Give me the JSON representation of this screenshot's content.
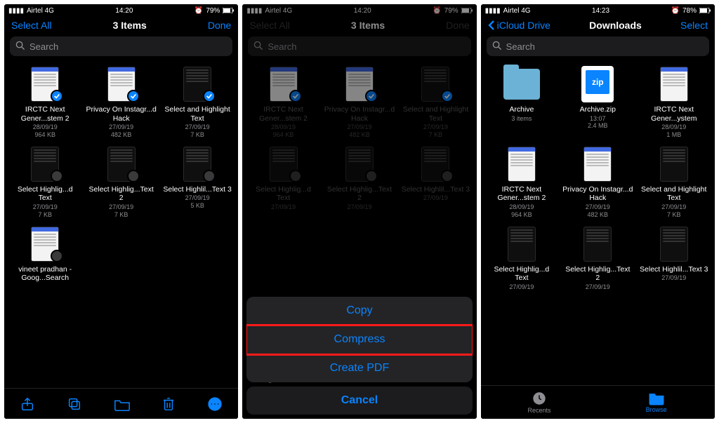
{
  "shared": {
    "carrier": "Airtel 4G",
    "signal_bars": 4,
    "search_placeholder": "Search"
  },
  "phone1": {
    "time": "14:20",
    "battery": "79%",
    "nav_left": "Select All",
    "nav_title": "3 Items",
    "nav_right": "Done",
    "files": [
      {
        "name": "IRCTC Next Gener...stem 2",
        "date": "28/09/19",
        "size": "964 KB",
        "thumb": "doc-light",
        "selected": true
      },
      {
        "name": "Privacy On Instagr...d Hack",
        "date": "27/09/19",
        "size": "482 KB",
        "thumb": "doc-light",
        "selected": true
      },
      {
        "name": "Select and Highlight Text",
        "date": "27/09/19",
        "size": "7 KB",
        "thumb": "doc-dark",
        "selected": true
      },
      {
        "name": "Select Highlig...d Text",
        "date": "27/09/19",
        "size": "7 KB",
        "thumb": "doc-dark",
        "selected": false
      },
      {
        "name": "Select Highlig...Text 2",
        "date": "27/09/19",
        "size": "7 KB",
        "thumb": "doc-dark",
        "selected": false
      },
      {
        "name": "Select Highlil...Text 3",
        "date": "27/09/19",
        "size": "5 KB",
        "thumb": "doc-dark",
        "selected": false
      },
      {
        "name": "vineet pradhan - Goog...Search",
        "date": "",
        "size": "",
        "thumb": "doc-light",
        "selected": false
      }
    ],
    "toolbar_icons": [
      "share",
      "duplicate",
      "move",
      "trash",
      "more"
    ]
  },
  "phone2": {
    "time": "14:20",
    "battery": "79%",
    "nav_left": "Select All",
    "nav_title": "3 Items",
    "nav_right": "Done",
    "files": [
      {
        "name": "IRCTC Next Gener...stem 2",
        "date": "28/09/19",
        "size": "964 KB",
        "thumb": "doc-light",
        "selected": true
      },
      {
        "name": "Privacy On Instagr...d Hack",
        "date": "27/09/19",
        "size": "482 KB",
        "thumb": "doc-light",
        "selected": true
      },
      {
        "name": "Select and Highlight Text",
        "date": "27/09/19",
        "size": "7 KB",
        "thumb": "doc-dark",
        "selected": true
      },
      {
        "name": "Select Highlig...d Text",
        "date": "27/09/19",
        "size": "",
        "thumb": "doc-dark",
        "selected": false
      },
      {
        "name": "Select Highlig...Text 2",
        "date": "27/09/19",
        "size": "",
        "thumb": "doc-dark",
        "selected": false
      },
      {
        "name": "Select Highlil...Text 3",
        "date": "27/09/19",
        "size": "",
        "thumb": "doc-dark",
        "selected": false
      }
    ],
    "peek_row": "- Goog   Search",
    "actions": [
      "Copy",
      "Compress",
      "Create PDF"
    ],
    "highlight_action_index": 1,
    "cancel": "Cancel"
  },
  "phone3": {
    "time": "14:23",
    "battery": "78%",
    "nav_back": "iCloud Drive",
    "nav_title": "Downloads",
    "nav_right": "Select",
    "files": [
      {
        "name": "Archive",
        "date": "3 items",
        "size": "",
        "thumb": "folder"
      },
      {
        "name": "Archive.zip",
        "date": "13:07",
        "size": "2.4 MB",
        "thumb": "zip"
      },
      {
        "name": "IRCTC Next Gener...ystem",
        "date": "28/09/19",
        "size": "1 MB",
        "thumb": "doc-light"
      },
      {
        "name": "IRCTC Next Gener...stem 2",
        "date": "28/09/19",
        "size": "964 KB",
        "thumb": "doc-light"
      },
      {
        "name": "Privacy On Instagr...d Hack",
        "date": "27/09/19",
        "size": "482 KB",
        "thumb": "doc-light"
      },
      {
        "name": "Select and Highlight Text",
        "date": "27/09/19",
        "size": "7 KB",
        "thumb": "doc-dark"
      },
      {
        "name": "Select Highlig...d Text",
        "date": "27/09/19",
        "size": "",
        "thumb": "doc-dark"
      },
      {
        "name": "Select Highlig...Text 2",
        "date": "27/09/19",
        "size": "",
        "thumb": "doc-dark"
      },
      {
        "name": "Select Highlil...Text 3",
        "date": "27/09/19",
        "size": "",
        "thumb": "doc-dark"
      }
    ],
    "tabs": [
      {
        "label": "Recents",
        "active": false
      },
      {
        "label": "Browse",
        "active": true
      }
    ]
  }
}
